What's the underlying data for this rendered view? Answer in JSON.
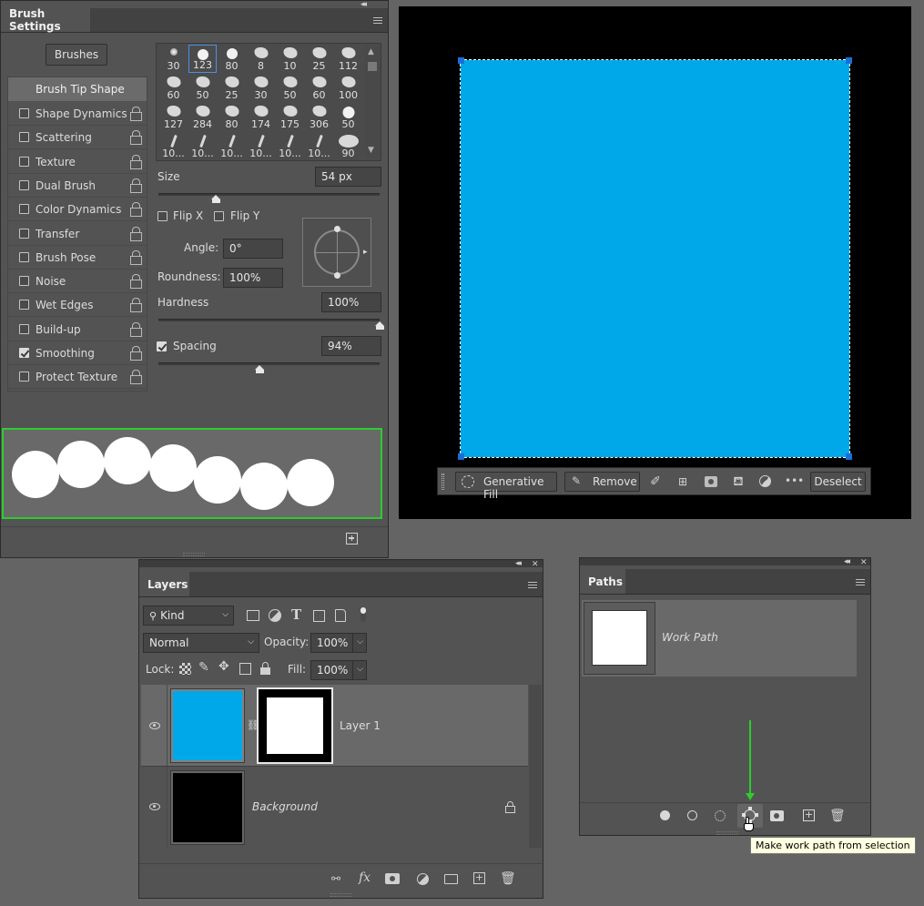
{
  "brush_settings": {
    "tab_title": "Brush Settings",
    "brushes_button": "Brushes",
    "tip_shape_label": "Brush Tip Shape",
    "options": [
      {
        "label": "Shape Dynamics",
        "checked": false
      },
      {
        "label": "Scattering",
        "checked": false
      },
      {
        "label": "Texture",
        "checked": false
      },
      {
        "label": "Dual Brush",
        "checked": false
      },
      {
        "label": "Color Dynamics",
        "checked": false
      },
      {
        "label": "Transfer",
        "checked": false
      },
      {
        "label": "Brush Pose",
        "checked": false
      },
      {
        "label": "Noise",
        "checked": false
      },
      {
        "label": "Wet Edges",
        "checked": false
      },
      {
        "label": "Build-up",
        "checked": false
      },
      {
        "label": "Smoothing",
        "checked": true
      },
      {
        "label": "Protect Texture",
        "checked": false
      }
    ],
    "brush_presets": [
      [
        "30",
        "123",
        "80",
        "8",
        "10",
        "25",
        "112"
      ],
      [
        "60",
        "50",
        "25",
        "30",
        "50",
        "60",
        "100"
      ],
      [
        "127",
        "284",
        "80",
        "174",
        "175",
        "306",
        "50"
      ],
      [
        "10...",
        "10...",
        "10...",
        "10...",
        "10...",
        "10...",
        "90"
      ]
    ],
    "size_label": "Size",
    "size_value": "54 px",
    "flip_x_label": "Flip X",
    "flip_y_label": "Flip Y",
    "angle_label": "Angle:",
    "angle_value": "0°",
    "roundness_label": "Roundness:",
    "roundness_value": "100%",
    "hardness_label": "Hardness",
    "hardness_value": "100%",
    "spacing_label": "Spacing",
    "spacing_value": "94%",
    "spacing_checked": true,
    "size_slider_fraction": 0.26,
    "hardness_slider_fraction": 1.0,
    "spacing_slider_fraction": 0.46
  },
  "canvas": {
    "fill_color": "#00a8ea",
    "background_color": "#000000",
    "taskbar": {
      "generative_fill_label": "Generative Fill",
      "remove_label": "Remove",
      "deselect_label": "Deselect",
      "more_label": "•••"
    }
  },
  "layers": {
    "tab_title": "Layers",
    "kind_label": "Kind",
    "blend_mode": "Normal",
    "opacity_label": "Opacity:",
    "opacity_value": "100%",
    "lock_label": "Lock:",
    "fill_label": "Fill:",
    "fill_value": "100%",
    "items": [
      {
        "name": "Layer 1",
        "thumb_color": "#00a8ea"
      },
      {
        "name": "Background",
        "thumb_color": "#000000"
      }
    ]
  },
  "paths": {
    "tab_title": "Paths",
    "items": [
      {
        "name": "Work Path"
      }
    ],
    "tooltip": "Make work path from selection"
  },
  "colors": {
    "highlight_green": "#2ecc2e",
    "panel_bg": "#535353",
    "selection_handle": "#1a6fd6"
  }
}
